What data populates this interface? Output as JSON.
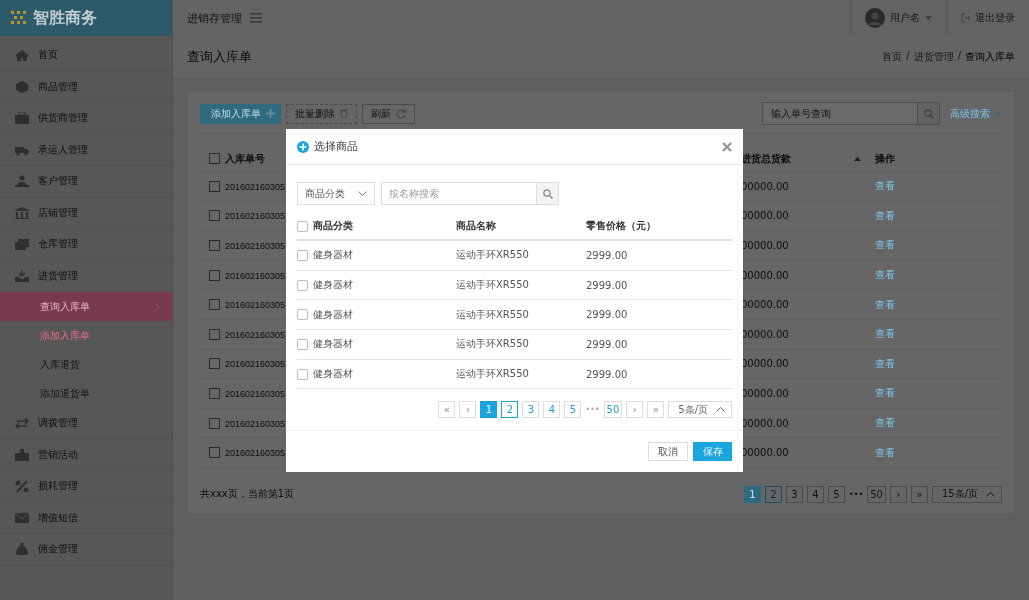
{
  "sidebar": {
    "logo": "智胜商务",
    "items": [
      {
        "label": "首页"
      },
      {
        "label": "商品管理"
      },
      {
        "label": "供货商管理"
      },
      {
        "label": "承运人管理"
      },
      {
        "label": "客户管理"
      },
      {
        "label": "店铺管理"
      },
      {
        "label": "仓库管理"
      },
      {
        "label": "进货管理",
        "expanded": true,
        "children": [
          {
            "label": "查询入库单",
            "selected": true,
            "highlighted": false
          },
          {
            "label": "添加入库单",
            "selected": false,
            "highlighted": true
          },
          {
            "label": "入库退货",
            "selected": false,
            "highlighted": false
          },
          {
            "label": "添加退货单",
            "selected": false,
            "highlighted": false
          }
        ]
      },
      {
        "label": "调拨管理"
      },
      {
        "label": "营销活动"
      },
      {
        "label": "损耗管理"
      },
      {
        "label": "增值短信"
      },
      {
        "label": "佣金管理"
      }
    ]
  },
  "topbar": {
    "module": "进销存管理",
    "user": "用户名",
    "logout": "退出登录"
  },
  "page": {
    "title": "查询入库单",
    "breadcrumb": {
      "items": [
        "首页",
        "进货管理",
        "查询入库单"
      ],
      "separator": "/"
    }
  },
  "toolbar": {
    "add": "添加入库单",
    "batch_delete": "批量删除",
    "refresh": "刷新",
    "search": {
      "placeholder": "输入单号查询"
    },
    "advanced": "高级搜索"
  },
  "table": {
    "header_checked": false,
    "columns": [
      {
        "label": "入库单号"
      },
      {
        "label": "进货总货款",
        "sort_ascending": true
      },
      {
        "label": "操作"
      }
    ],
    "rows": [
      {
        "checked": false,
        "id": "201602160305",
        "amount": "00000.00",
        "action": "查看"
      },
      {
        "checked": false,
        "id": "201602160305",
        "amount": "00000.00",
        "action": "查看"
      },
      {
        "checked": false,
        "id": "201602160305",
        "amount": "00000.00",
        "action": "查看"
      },
      {
        "checked": false,
        "id": "201602160305",
        "amount": "00000.00",
        "action": "查看"
      },
      {
        "checked": false,
        "id": "201602160305",
        "amount": "00000.00",
        "action": "查看"
      },
      {
        "checked": false,
        "id": "201602160305",
        "amount": "00000.00",
        "action": "查看"
      },
      {
        "checked": false,
        "id": "201602160305",
        "amount": "00000.00",
        "action": "查看"
      },
      {
        "checked": false,
        "id": "201602160305",
        "amount": "00000.00",
        "action": "查看"
      },
      {
        "checked": false,
        "id": "201602160305",
        "amount": "00000.00",
        "action": "查看"
      },
      {
        "checked": false,
        "id": "201602160305",
        "amount": "00000.00",
        "action": "查看"
      }
    ]
  },
  "footer": {
    "summary": "共xxx页，当前第1页",
    "pagination": {
      "items": [
        {
          "kind": "page",
          "label": "1",
          "selected": true,
          "focused": false
        },
        {
          "kind": "page",
          "label": "2",
          "selected": false,
          "focused": true
        },
        {
          "kind": "page",
          "label": "3",
          "selected": false,
          "focused": false
        },
        {
          "kind": "page",
          "label": "4",
          "selected": false,
          "focused": false
        },
        {
          "kind": "page",
          "label": "5",
          "selected": false,
          "focused": false
        },
        {
          "kind": "ellipsis",
          "label": "•••"
        },
        {
          "kind": "page",
          "label": "50",
          "selected": false,
          "focused": false
        }
      ],
      "next": "›",
      "last": "»",
      "page_size": "15条/页"
    }
  },
  "modal": {
    "title": "选择商品",
    "filter": {
      "category": "商品分类",
      "search": {
        "placeholder": "按名称搜索"
      }
    },
    "table": {
      "header_checked": false,
      "columns": [
        "商品分类",
        "商品名称",
        "零售价格（元）"
      ],
      "rows": [
        {
          "checked": false,
          "category": "健身器材",
          "name": "运动手环XR550",
          "price": "2999.00"
        },
        {
          "checked": false,
          "category": "健身器材",
          "name": "运动手环XR550",
          "price": "2999.00"
        },
        {
          "checked": false,
          "category": "健身器材",
          "name": "运动手环XR550",
          "price": "2999.00"
        },
        {
          "checked": false,
          "category": "健身器材",
          "name": "运动手环XR550",
          "price": "2999.00"
        },
        {
          "checked": false,
          "category": "健身器材",
          "name": "运动手环XR550",
          "price": "2999.00"
        }
      ]
    },
    "pagination": {
      "first": "«",
      "prev": "‹",
      "items": [
        {
          "kind": "page",
          "label": "1",
          "selected": true,
          "focused": false
        },
        {
          "kind": "page",
          "label": "2",
          "selected": false,
          "focused": true
        },
        {
          "kind": "page",
          "label": "3",
          "selected": false,
          "focused": false
        },
        {
          "kind": "page",
          "label": "4",
          "selected": false,
          "focused": false
        },
        {
          "kind": "page",
          "label": "5",
          "selected": false,
          "focused": false
        },
        {
          "kind": "ellipsis",
          "label": "•••"
        },
        {
          "kind": "page",
          "label": "50",
          "selected": false,
          "focused": false
        }
      ],
      "next": "›",
      "last": "»",
      "page_size": "5条/页"
    },
    "buttons": {
      "cancel": "取消",
      "save": "保存"
    }
  }
}
